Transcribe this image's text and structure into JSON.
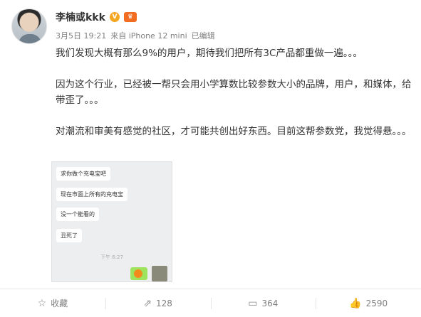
{
  "author": {
    "name": "李楠或kkk",
    "verified_icon": "verified-badge-icon",
    "vip_icon": "vip-badge-icon"
  },
  "meta": {
    "date": "3月5日 19:21",
    "source": "来自 iPhone 12 mini",
    "edited": "已编辑"
  },
  "post": {
    "paragraphs": [
      "我们发现大概有那么9%的用户，期待我们把所有3C产品都重做一遍。。。",
      "因为这个行业，已经被一帮只会用小学算数比较参数大小的品牌，用户，和媒体，给带歪了。。。",
      "对潮流和审美有感觉的社区，才可能共创出好东西。目前这帮参数党，我觉得悬。。。"
    ]
  },
  "image": {
    "messages": [
      "求你做个充电宝吧",
      "现在市面上所有的充电宝",
      "没一个能看的",
      "丑死了"
    ],
    "time": "下午 6:27"
  },
  "actions": {
    "favorite": {
      "label": "收藏",
      "icon": "star-icon"
    },
    "repost": {
      "count": "128",
      "icon": "repost-icon"
    },
    "comment": {
      "count": "364",
      "icon": "comment-icon"
    },
    "like": {
      "count": "2590",
      "icon": "thumbs-up-icon"
    }
  }
}
